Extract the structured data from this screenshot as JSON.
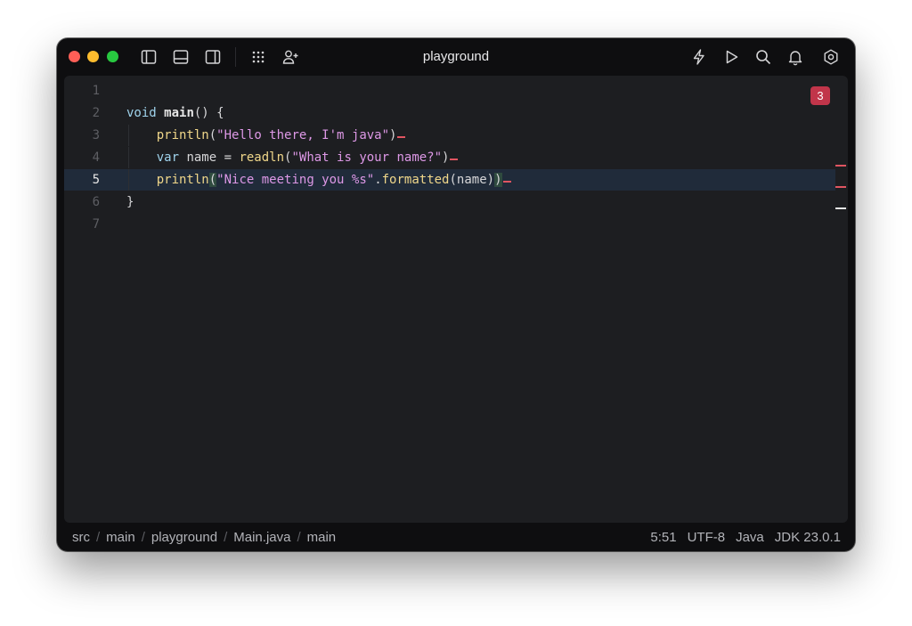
{
  "window": {
    "title": "playground"
  },
  "toolbar": {
    "left_icons": [
      "left-sidebar-toggle-icon",
      "bottom-panel-toggle-icon",
      "right-sidebar-toggle-icon",
      "apps-grid-icon",
      "add-user-icon"
    ],
    "right_icons": [
      "lightning-icon",
      "run-icon",
      "search-icon",
      "bell-icon",
      "settings-icon"
    ]
  },
  "editor": {
    "error_count": "3",
    "current_line": 5,
    "lines": [
      {
        "number": "1",
        "code": ""
      },
      {
        "number": "2",
        "code": "void main() {"
      },
      {
        "number": "3",
        "code": "println(\"Hello there, I'm java\")"
      },
      {
        "number": "4",
        "code": "var name = readln(\"What is your name?\")"
      },
      {
        "number": "5",
        "code": "println(\"Nice meeting you %s\".formatted(name))"
      },
      {
        "number": "6",
        "code": "}"
      },
      {
        "number": "7",
        "code": ""
      }
    ],
    "tokens": {
      "l2": {
        "kw": "void",
        "fn": "main",
        "rest": "() {"
      },
      "l3": {
        "fn": "println",
        "open": "(",
        "str": "\"Hello there, I'm java\"",
        "close": ")"
      },
      "l4": {
        "kw": "var",
        "mid": " name = ",
        "fn": "readln",
        "open": "(",
        "str": "\"What is your name?\"",
        "close": ")"
      },
      "l5": {
        "fn": "println",
        "open": "(",
        "str": "\"Nice meeting you %s\"",
        "dot": ".",
        "fn2": "formatted",
        "args": "(name)",
        "close": ")"
      },
      "l6": {
        "brace": "}"
      }
    },
    "colors": {
      "keyword": "#9fd3ec",
      "function": "#f0d78a",
      "string": "#dd98e6",
      "error": "#e05561"
    }
  },
  "statusbar": {
    "breadcrumbs": [
      "src",
      "main",
      "playground",
      "Main.java",
      "main"
    ],
    "separator": "/",
    "cursor_position": "5:51",
    "encoding": "UTF-8",
    "language": "Java",
    "sdk": "JDK 23.0.1"
  }
}
